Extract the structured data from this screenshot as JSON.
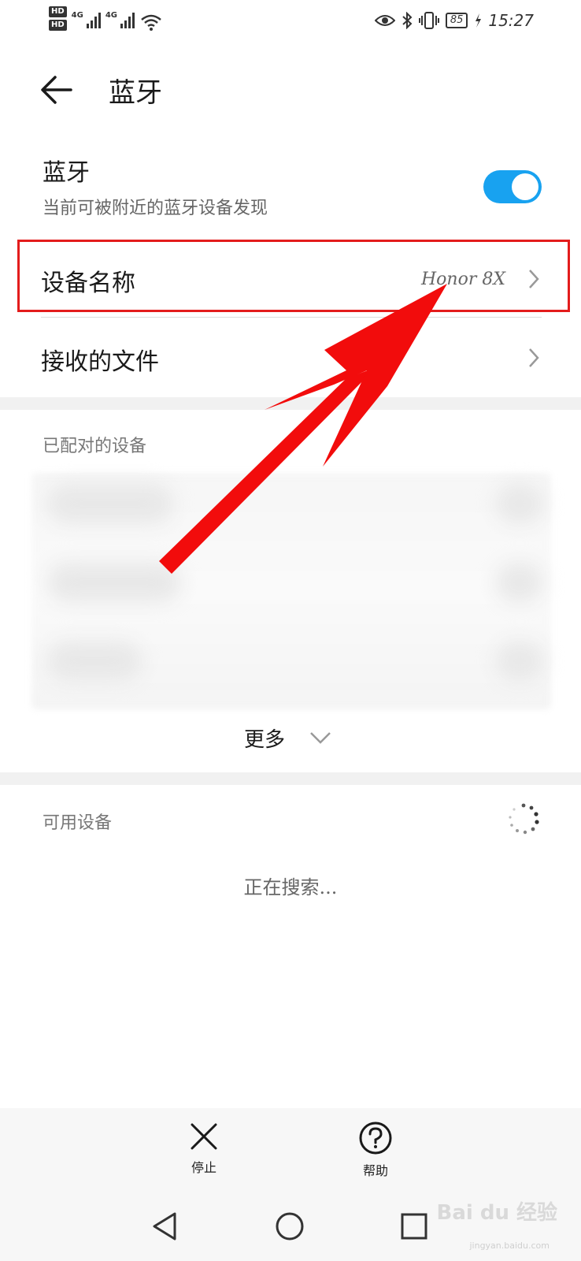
{
  "status_bar": {
    "hd1": "HD",
    "hd2": "HD",
    "net1": "4G",
    "net2": "4G",
    "battery": "85",
    "time": "15:27"
  },
  "header": {
    "title": "蓝牙"
  },
  "bluetooth": {
    "title": "蓝牙",
    "subtitle": "当前可被附近的蓝牙设备发现",
    "enabled": true,
    "accent_color": "#18a2f0"
  },
  "device_name": {
    "label": "设备名称",
    "value": "Honor 8X"
  },
  "received_files": {
    "label": "接收的文件"
  },
  "paired": {
    "title": "已配对的设备",
    "more_label": "更多"
  },
  "available": {
    "title": "可用设备",
    "searching": "正在搜索..."
  },
  "actions": {
    "stop_label": "停止",
    "help_label": "帮助"
  },
  "annotation": {
    "color": "#e31c1c"
  },
  "watermark": {
    "brand": "Bai du 经验",
    "site": "jingyan.baidu.com"
  }
}
